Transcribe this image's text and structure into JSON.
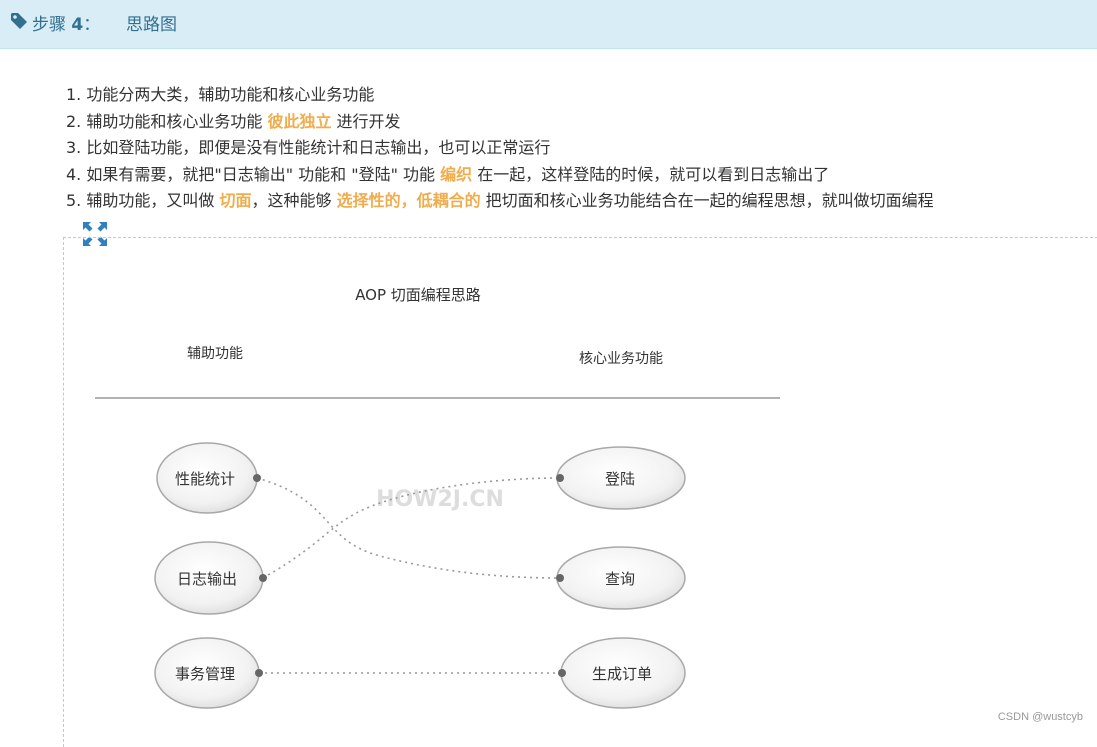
{
  "header": {
    "step_label": "步骤",
    "step_number": "4",
    "step_colon": "：",
    "step_title": "思路图"
  },
  "list": [
    {
      "num": "1.",
      "parts": [
        {
          "t": "功能分两大类，辅助功能和核心业务功能",
          "h": false
        }
      ]
    },
    {
      "num": "2.",
      "parts": [
        {
          "t": "辅助功能和核心业务功能 ",
          "h": false
        },
        {
          "t": "彼此独立",
          "h": true
        },
        {
          "t": " 进行开发",
          "h": false
        }
      ]
    },
    {
      "num": "3.",
      "parts": [
        {
          "t": "比如登陆功能，即便是没有性能统计和日志输出，也可以正常运行",
          "h": false
        }
      ]
    },
    {
      "num": "4.",
      "parts": [
        {
          "t": "如果有需要，就把\"日志输出\" 功能和 \"登陆\" 功能 ",
          "h": false
        },
        {
          "t": "编织",
          "h": true
        },
        {
          "t": " 在一起，这样登陆的时候，就可以看到日志输出了",
          "h": false
        }
      ]
    },
    {
      "num": "5.",
      "parts": [
        {
          "t": "辅助功能，又叫做 ",
          "h": false
        },
        {
          "t": "切面",
          "h": true
        },
        {
          "t": "，这种能够 ",
          "h": false
        },
        {
          "t": "选择性的，低耦合的",
          "h": true
        },
        {
          "t": " 把切面和核心业务功能结合在一起的编程思想，就叫做切面编程",
          "h": false
        }
      ]
    }
  ],
  "diagram": {
    "title": "AOP 切面编程思路",
    "left_header": "辅助功能",
    "right_header": "核心业务功能",
    "watermark": "HOW2J.CN",
    "left_nodes": [
      "性能统计",
      "日志输出",
      "事务管理"
    ],
    "right_nodes": [
      "登陆",
      "查询",
      "生成订单"
    ]
  },
  "credit": "CSDN @wustcyb",
  "colors": {
    "header_bg": "#d9edf7",
    "header_text": "#31708f",
    "highlight": "#f0ad4e",
    "icon_blue": "#2f7fc1"
  }
}
